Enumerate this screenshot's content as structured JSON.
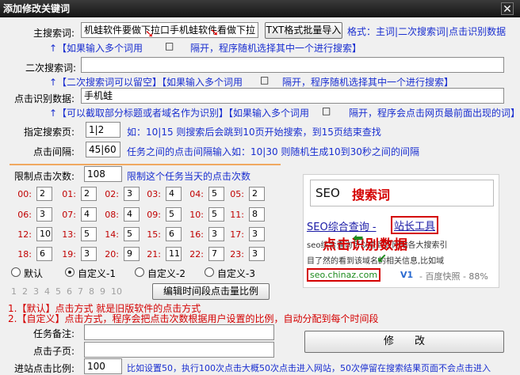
{
  "window": {
    "title": "添加修改关键词",
    "close_glyph": "✕"
  },
  "main_keyword": {
    "label": "主搜索词:",
    "value": "机蛙软件要做下拉口手机蛙软件看做下拉",
    "batch_button": "TXT格式批量导入",
    "format_hint": "格式：主词|二次搜索词|点击识别数据",
    "hint_left": "↑【如果输入多个词用",
    "hint_right": "隔开，程序随机选择其中一个进行搜索】"
  },
  "secondary_keyword": {
    "label": "二次搜索词:",
    "value": "",
    "hint_left": "↑【二次搜索词可以留空】【如果输入多个词用",
    "hint_right": "隔开，程序随机选择其中一个进行搜索】"
  },
  "click_data": {
    "label": "点击识别数据:",
    "value": "手机蛙",
    "hint_left": "↑【可以截取部分标题或者域名作为识别】【如果输入多个词用",
    "hint_right": "隔开，程序会点击网页最前面出现的词】"
  },
  "search_page": {
    "label": "指定搜索页:",
    "value": "1|2",
    "hint": "如：10|15 则搜索后会跳到10页开始搜索，到15页结束查找"
  },
  "click_interval": {
    "label": "点击间隔:",
    "value": "45|60",
    "hint": "任务之间的点击间隔输入如：10|30 则随机生成10到30秒之间的间隔"
  },
  "click_limit": {
    "label": "限制点击次数:",
    "value": "108",
    "hint": "限制这个任务当天的点击次数"
  },
  "hours": [
    {
      "label": "00:",
      "value": "2"
    },
    {
      "label": "01:",
      "value": "2"
    },
    {
      "label": "02:",
      "value": "3"
    },
    {
      "label": "03:",
      "value": "4"
    },
    {
      "label": "04:",
      "value": "5"
    },
    {
      "label": "05:",
      "value": "2"
    },
    {
      "label": "06:",
      "value": "3"
    },
    {
      "label": "07:",
      "value": "4"
    },
    {
      "label": "08:",
      "value": "4"
    },
    {
      "label": "09:",
      "value": "5"
    },
    {
      "label": "10:",
      "value": "5"
    },
    {
      "label": "11:",
      "value": "8"
    },
    {
      "label": "12:",
      "value": "10"
    },
    {
      "label": "13:",
      "value": "5"
    },
    {
      "label": "14:",
      "value": "5"
    },
    {
      "label": "15:",
      "value": "6"
    },
    {
      "label": "16:",
      "value": "3"
    },
    {
      "label": "17:",
      "value": "3"
    },
    {
      "label": "18:",
      "value": "6"
    },
    {
      "label": "19:",
      "value": "3"
    },
    {
      "label": "20:",
      "value": "9"
    },
    {
      "label": "21:",
      "value": "11"
    },
    {
      "label": "22:",
      "value": "7"
    },
    {
      "label": "23:",
      "value": "3"
    }
  ],
  "modes": [
    {
      "label": "默认",
      "checked": false
    },
    {
      "label": "自定义-1",
      "checked": true
    },
    {
      "label": "自定义-2",
      "checked": false
    },
    {
      "label": "自定义-3",
      "checked": false
    }
  ],
  "page_tabs": [
    "1",
    "2",
    "3",
    "4",
    "5",
    "6",
    "7",
    "8",
    "9",
    "10"
  ],
  "edit_ratio_button": "编辑时间段点击量比例",
  "notes": {
    "line1": "1.【默认】点击方式 就是旧版软件的点击方式",
    "line2": "2.【自定义】点击方式，程序会把点击次数根据用户设置的比例，自动分配到每个时间段"
  },
  "task_note": {
    "label": "任务备注:",
    "value": ""
  },
  "click_page": {
    "label": "点击子页:",
    "value": ""
  },
  "enter_ratio": {
    "label": "进站点击比例:",
    "value": "100",
    "hint": "比如设置50，执行100次点击大概50次点击进入网站，50次停留在搜索结果页面不会点击进入"
  },
  "modify_button": "修　　改",
  "preview": {
    "seo_label": "SEO",
    "search_word_label": "搜索词",
    "result_title_prefix": "SEO综合查询 - ",
    "result_title_box": "站长工具",
    "overlay_label": "点击识别数据",
    "snippet_line1": "seo综合查询可以查到该网站各大搜索引",
    "snippet_line2": "目了然的看到该域名的相关信息,比如域",
    "url_box": "seo.chinaz.com",
    "v1": "V1",
    "snapshot": "- 百度快照 - 88%",
    "colors": {
      "red": "#d40000",
      "green": "#1c8a1c",
      "link_blue": "#1a1aa6"
    }
  }
}
